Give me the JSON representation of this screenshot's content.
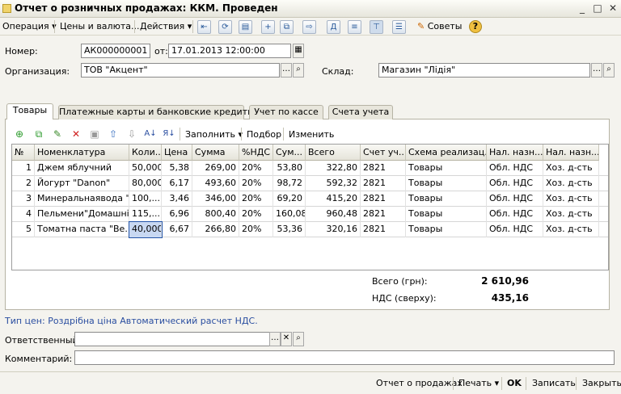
{
  "window": {
    "title": "Отчет о розничных продажах: ККМ. Проведен",
    "btn_min": "_",
    "btn_max": "□",
    "btn_close": "✕"
  },
  "menu": {
    "operation": "Операция",
    "prices": "Цены и валюта...",
    "actions": "Действия",
    "advice": "Советы"
  },
  "form": {
    "number_label": "Номер:",
    "number": "АК000000001",
    "from_label": "от:",
    "date": "17.01.2013 12:00:00",
    "org_label": "Организация:",
    "org": "ТОВ \"Акцент\"",
    "warehouse_label": "Склад:",
    "warehouse": "Магазин \"Лідія\""
  },
  "tabs": [
    "Товары",
    "Платежные карты и банковские кредиты",
    "Учет по кассе",
    "Счета учета"
  ],
  "table_toolbar": {
    "fill": "Заполнить",
    "pick": "Подбор",
    "change": "Изменить"
  },
  "columns": [
    "№",
    "Номенклатура",
    "Коли...",
    "Цена",
    "Сумма",
    "%НДС",
    "Сум...",
    "Всего",
    "Счет уч...",
    "Схема реализац...",
    "Нал. назн....",
    "Нал. назн...."
  ],
  "rows": [
    [
      "1",
      "Джем яблучний",
      "50,000",
      "5,38",
      "269,00",
      "20%",
      "53,80",
      "322,80",
      "2821",
      "Товары",
      "Обл. НДС",
      "Хоз. д-сть"
    ],
    [
      "2",
      "Йогурт \"Danon\"",
      "80,000",
      "6,17",
      "493,60",
      "20%",
      "98,72",
      "592,32",
      "2821",
      "Товары",
      "Обл. НДС",
      "Хоз. д-сть"
    ],
    [
      "3",
      "Минеральнаявода \"...",
      "100,...",
      "3,46",
      "346,00",
      "20%",
      "69,20",
      "415,20",
      "2821",
      "Товары",
      "Обл. НДС",
      "Хоз. д-сть"
    ],
    [
      "4",
      "Пельмени\"Домашні\"",
      "115,...",
      "6,96",
      "800,40",
      "20%",
      "160,08",
      "960,48",
      "2821",
      "Товары",
      "Обл. НДС",
      "Хоз. д-сть"
    ],
    [
      "5",
      "Томатна паста \"Ве...",
      "40,000",
      "6,67",
      "266,80",
      "20%",
      "53,36",
      "320,16",
      "2821",
      "Товары",
      "Обл. НДС",
      "Хоз. д-сть"
    ]
  ],
  "totals": {
    "total_label": "Всего (грн):",
    "total": "2 610,96",
    "vat_label": "НДС (сверху):",
    "vat": "435,16"
  },
  "price_type": "Тип цен: Роздрібна ціна Автоматический расчет НДС.",
  "responsible_label": "Ответственный:",
  "comment_label": "Комментарий:",
  "footer": {
    "report": "Отчет о продажах",
    "print": "Печать",
    "ok": "OK",
    "save": "Записать",
    "close": "Закрыть"
  },
  "colors": {
    "link_blue": "#2a4ea0",
    "selection": "#c8d8f2"
  }
}
